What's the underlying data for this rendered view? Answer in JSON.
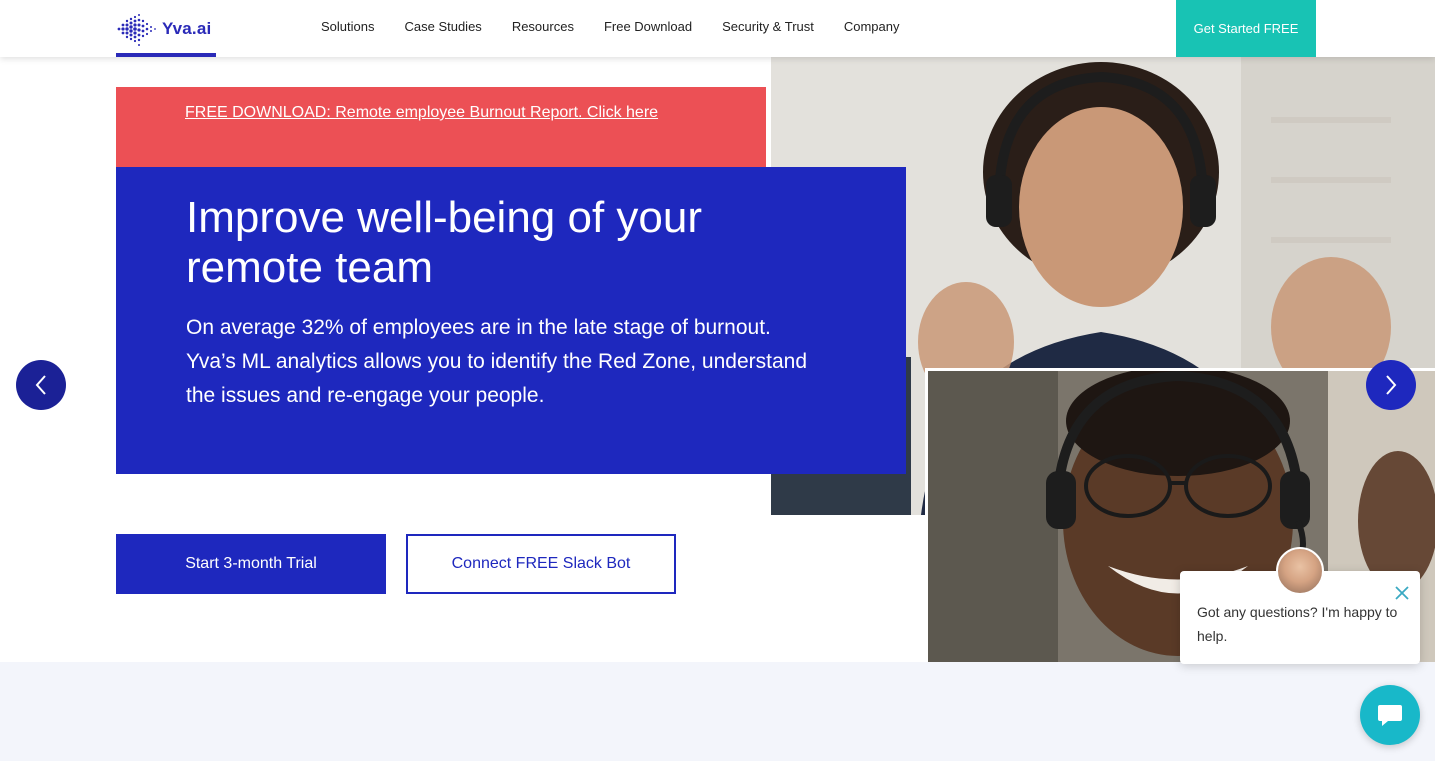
{
  "colors": {
    "brand_blue": "#1e28be",
    "teal": "#18c3b4",
    "banner_red": "#ec5055",
    "lower_bg": "#f3f5fb"
  },
  "header": {
    "logo_text": "Yva.ai",
    "logo_icon": "yva-dots-logo-icon",
    "nav": [
      {
        "label": "Solutions"
      },
      {
        "label": "Case Studies"
      },
      {
        "label": "Resources"
      },
      {
        "label": "Free Download"
      },
      {
        "label": "Security & Trust"
      },
      {
        "label": "Company"
      }
    ],
    "cta_label": "Get Started FREE"
  },
  "hero": {
    "banner_link": "FREE DOWNLOAD: Remote employee Burnout Report. Click here",
    "title": "Improve well-being of your remote team",
    "subtitle": "On average 32% of employees are in the late stage of burnout. Yva’s ML analytics allows you to identify the Red Zone, understand the issues and re-engage your people.",
    "primary_button": "Start 3-month Trial",
    "secondary_button": "Connect FREE Slack Bot",
    "prev_icon": "chevron-left-icon",
    "next_icon": "chevron-right-icon"
  },
  "chat": {
    "message": "Got any questions? I'm happy to help.",
    "close_icon": "close-icon",
    "launcher_icon": "chat-icon"
  }
}
